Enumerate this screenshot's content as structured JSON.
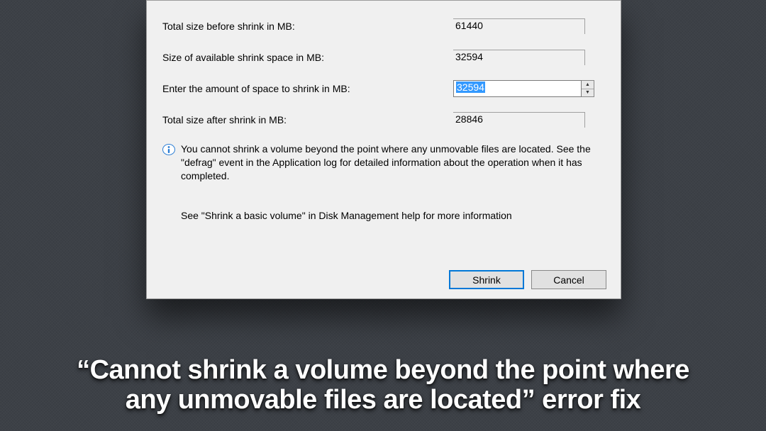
{
  "dialog": {
    "rows": {
      "total_before": {
        "label": "Total size before shrink in MB:",
        "value": "61440"
      },
      "available": {
        "label": "Size of available shrink space in MB:",
        "value": "32594"
      },
      "enter": {
        "label": "Enter the amount of space to shrink in MB:",
        "value": "32594"
      },
      "total_after": {
        "label": "Total size after shrink in MB:",
        "value": "28846"
      }
    },
    "info_text": "You cannot shrink a volume beyond the point where any unmovable files are located. See the \"defrag\" event in the Application log for detailed information about the operation when it has completed.",
    "see_also": "See \"Shrink a basic volume\" in Disk Management help for more information",
    "buttons": {
      "shrink": "Shrink",
      "cancel": "Cancel"
    }
  },
  "caption_line1": "“Cannot shrink a volume beyond the point where",
  "caption_line2": "any unmovable files are located” error fix"
}
